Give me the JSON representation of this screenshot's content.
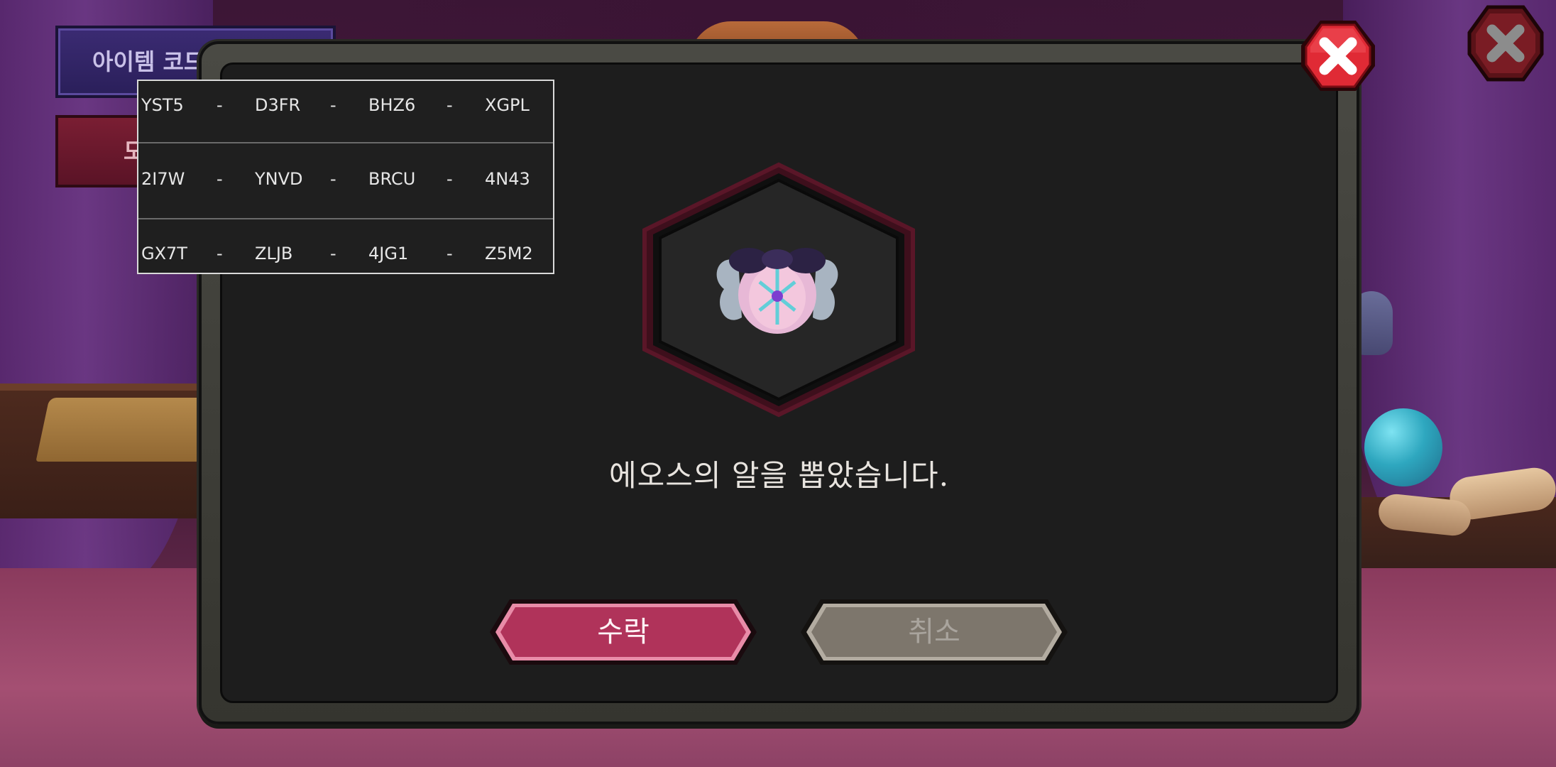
{
  "background": {
    "item_code_button_label": "아이템 코드",
    "red_button_label": "도"
  },
  "dialog": {
    "message": "에오스의 알을 뽑았습니다.",
    "accept_label": "수락",
    "cancel_label": "취소",
    "item_icon": "eos-egg-icon"
  },
  "code_panel": {
    "rows": [
      [
        "YST5",
        "-",
        "D3FR",
        "-",
        "BHZ6",
        "-",
        "XGPL"
      ],
      [
        "2I7W",
        "-",
        "YNVD",
        "-",
        "BRCU",
        "-",
        "4N43"
      ],
      [
        "GX7T",
        "-",
        "ZLJB",
        "-",
        "4JG1",
        "-",
        "Z5M2"
      ]
    ]
  },
  "colors": {
    "accept": "#b0335a",
    "cancel": "#7d766c",
    "close": "#d0202b",
    "hex_border": "#5a1628"
  }
}
